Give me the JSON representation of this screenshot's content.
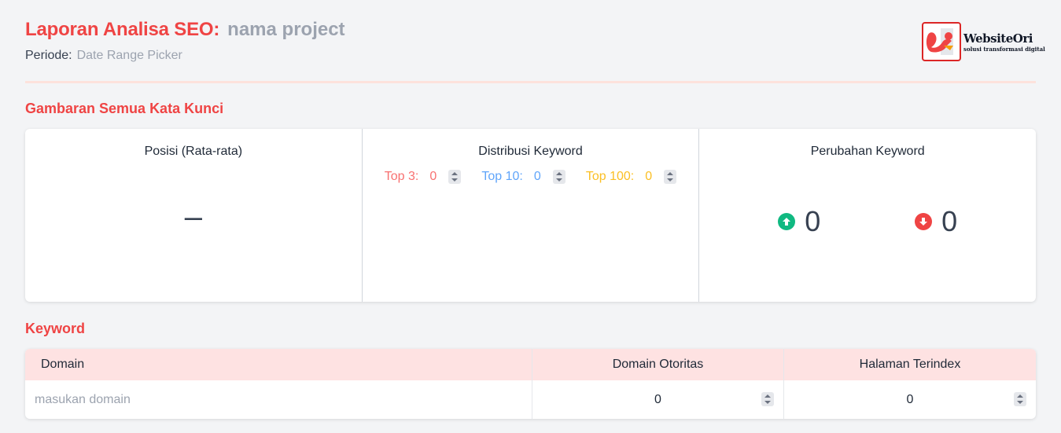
{
  "header": {
    "title": "Laporan Analisa SEO:",
    "project_placeholder": "nama project",
    "periode_label": "Periode:",
    "periode_placeholder": "Date Range Picker"
  },
  "logo": {
    "name": "WebsiteOri",
    "tagline": "solusi transformasi digital"
  },
  "sections": {
    "overview_title": "Gambaran Semua Kata Kunci",
    "keyword_title": "Keyword"
  },
  "overview": {
    "position": {
      "title": "Posisi (Rata-rata)",
      "value": "–"
    },
    "distribution": {
      "title": "Distribusi Keyword",
      "top3_label": "Top 3:",
      "top3_value": "0",
      "top10_label": "Top 10:",
      "top10_value": "0",
      "top100_label": "Top 100:",
      "top100_value": "0"
    },
    "change": {
      "title": "Perubahan Keyword",
      "up_value": "0",
      "down_value": "0"
    }
  },
  "keyword_table": {
    "headers": [
      "Domain",
      "Domain Otoritas",
      "Halaman Terindex"
    ],
    "domain_placeholder": "masukan domain",
    "domain_authority": "0",
    "indexed_pages": "0"
  },
  "colors": {
    "accent": "#ef4444",
    "top3": "#f87171",
    "top10": "#60a5fa",
    "top100": "#fbbf24",
    "up": "#10b981",
    "down": "#ef4444",
    "table_header": "#fee2e2"
  },
  "icons": {
    "up": "arrow-up-circle-icon",
    "down": "arrow-down-circle-icon"
  }
}
